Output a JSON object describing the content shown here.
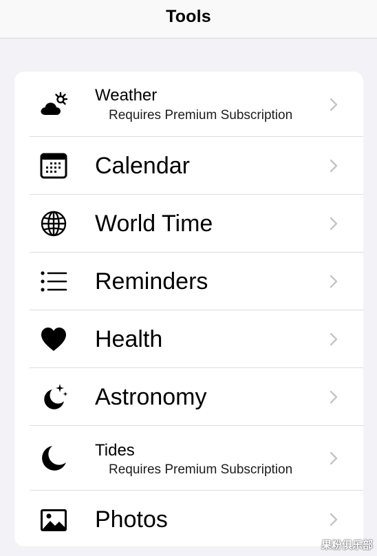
{
  "navbar": {
    "title": "Tools"
  },
  "tools": {
    "items": [
      {
        "label": "Weather",
        "sublabel": "Requires Premium Subscription",
        "icon": "cloud-sun-icon"
      },
      {
        "label": "Calendar",
        "icon": "calendar-icon"
      },
      {
        "label": "World Time",
        "icon": "globe-icon"
      },
      {
        "label": "Reminders",
        "icon": "list-bullet-icon"
      },
      {
        "label": "Health",
        "icon": "heart-icon"
      },
      {
        "label": "Astronomy",
        "icon": "moon-stars-icon"
      },
      {
        "label": "Tides",
        "sublabel": "Requires Premium Subscription",
        "icon": "moon-icon"
      },
      {
        "label": "Photos",
        "icon": "photo-icon"
      }
    ]
  },
  "watermark": {
    "text": "果粉俱乐部"
  },
  "colors": {
    "background": "#f2f2f7",
    "card": "#ffffff",
    "chevron": "#c4c4c7",
    "divider": "#dcdce0"
  }
}
